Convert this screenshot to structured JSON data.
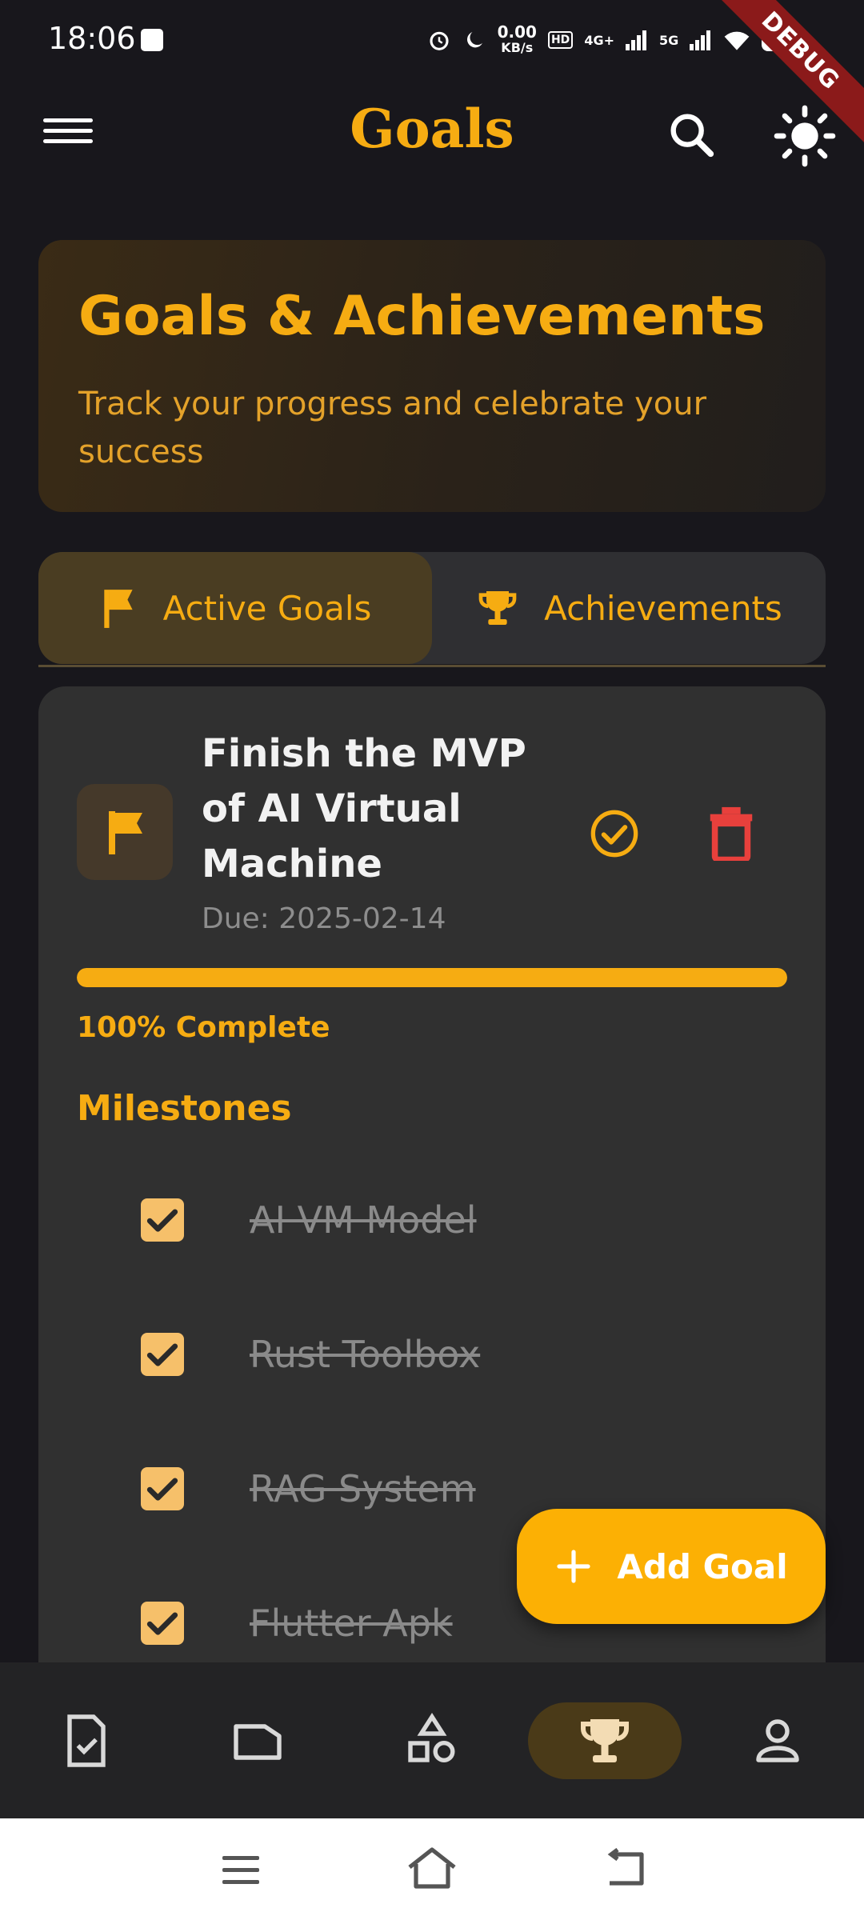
{
  "status_bar": {
    "time": "18:06",
    "net_speed_value": "0.00",
    "net_speed_unit": "KB/s",
    "signal_1": "4G+",
    "signal_2": "5G",
    "battery": "100",
    "debug_label": "DEBUG"
  },
  "app_bar": {
    "title": "Goals"
  },
  "hero": {
    "title": "Goals & Achievements",
    "subtitle": "Track your progress and celebrate your success"
  },
  "tabs": [
    {
      "label": "Active Goals",
      "icon": "flag-icon",
      "active": true
    },
    {
      "label": "Achievements",
      "icon": "trophy-icon",
      "active": false
    }
  ],
  "goal": {
    "title": "Finish the MVP of AI Virtual Machine",
    "due": "Due: 2025-02-14",
    "progress_fraction": 1.0,
    "progress_text": "100% Complete",
    "milestones_title": "Milestones",
    "milestones": [
      {
        "label": "AI VM Model",
        "done": true
      },
      {
        "label": "Rust Toolbox",
        "done": true
      },
      {
        "label": "RAG System",
        "done": true
      },
      {
        "label": "Flutter Apk",
        "done": true
      }
    ]
  },
  "fab": {
    "label": "Add Goal"
  },
  "bottom_nav": [
    {
      "name": "tasks",
      "icon": "task-check-icon",
      "active": false
    },
    {
      "name": "notes",
      "icon": "folder-icon",
      "active": false
    },
    {
      "name": "shapes",
      "icon": "shapes-icon",
      "active": false
    },
    {
      "name": "goals",
      "icon": "trophy-icon",
      "active": true
    },
    {
      "name": "profile",
      "icon": "person-icon",
      "active": false
    }
  ],
  "colors": {
    "accent": "#f6ac12",
    "background": "#18171c",
    "card": "#303030",
    "delete": "#e8403c"
  }
}
